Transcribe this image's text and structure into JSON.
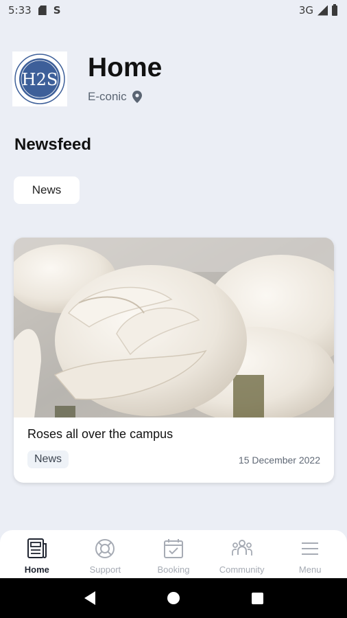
{
  "status_bar": {
    "time": "5:33",
    "network": "3G"
  },
  "header": {
    "title": "Home",
    "location": "E-conic",
    "logo_text": "H2S"
  },
  "newsfeed": {
    "title": "Newsfeed",
    "filter_chip": "News",
    "cards": [
      {
        "title": "Roses all over the campus",
        "tag": "News",
        "date": "15 December 2022"
      }
    ]
  },
  "bottom_nav": {
    "items": [
      {
        "label": "Home",
        "icon": "newspaper-icon",
        "active": true
      },
      {
        "label": "Support",
        "icon": "lifebuoy-icon",
        "active": false
      },
      {
        "label": "Booking",
        "icon": "calendar-check-icon",
        "active": false
      },
      {
        "label": "Community",
        "icon": "people-icon",
        "active": false
      },
      {
        "label": "Menu",
        "icon": "hamburger-icon",
        "active": false
      }
    ]
  },
  "colors": {
    "background": "#ebeef5",
    "logo_blue": "#3d5f99",
    "active_nav": "#1f2430",
    "inactive_nav": "#a6abb4"
  }
}
